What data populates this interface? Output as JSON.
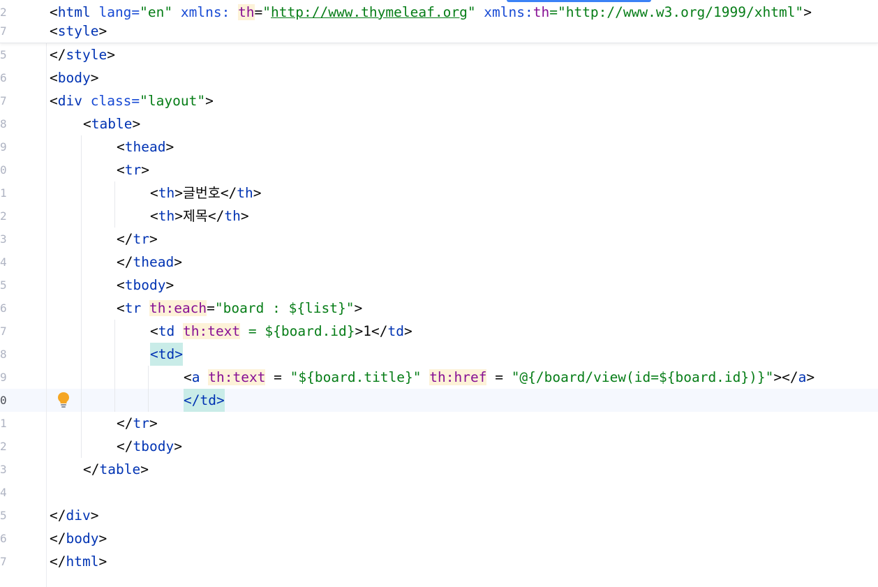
{
  "sticky": {
    "line_html": {
      "number": "2",
      "lt": "<",
      "tag": "html",
      "attr1": " lang=",
      "val1": "\"en\"",
      "attr2": " xmlns: ",
      "th1": "th",
      "eq": "=",
      "q1": "\"",
      "url": "http://www.thymeleaf.org",
      "q2": "\"",
      "attr3": " xmlns:",
      "th2": "th",
      "val3": "=\"http://www.w3.org/1999/xhtml\"",
      "gt": ">"
    },
    "line_style": {
      "number": "7",
      "open": "<",
      "tag": "style",
      "close": ">"
    }
  },
  "lines": {
    "l5": {
      "number": "5",
      "open": "</",
      "tag": "style",
      "close": ">"
    },
    "l6": {
      "number": "6",
      "open": "<",
      "tag": "body",
      "close": ">"
    },
    "l7": {
      "number": "7",
      "open": "<",
      "tag": "div",
      "attr": " class=",
      "val": "\"layout\"",
      "close": ">"
    },
    "l8": {
      "number": "8",
      "open": "<",
      "tag": "table",
      "close": ">"
    },
    "l9": {
      "number": "9",
      "open": "<",
      "tag": "thead",
      "close": ">"
    },
    "l10": {
      "number": "0",
      "open": "<",
      "tag": "tr",
      "close": ">"
    },
    "l11": {
      "number": "1",
      "open": "<",
      "tag": "th",
      "close": ">",
      "text": "글번호",
      "open2": "</",
      "tag2": "th",
      "close2": ">"
    },
    "l12": {
      "number": "2",
      "open": "<",
      "tag": "th",
      "close": ">",
      "text": "제목",
      "open2": "</",
      "tag2": "th",
      "close2": ">"
    },
    "l13": {
      "number": "3",
      "open": "</",
      "tag": "tr",
      "close": ">"
    },
    "l14": {
      "number": "4",
      "open": "</",
      "tag": "thead",
      "close": ">"
    },
    "l15": {
      "number": "5",
      "open": "<",
      "tag": "tbody",
      "close": ">"
    },
    "l16": {
      "number": "6",
      "open": "<",
      "tag": "tr",
      "sp": " ",
      "th": "th:each",
      "eq": "=",
      "val": "\"board : ${list}\"",
      "close": ">"
    },
    "l17": {
      "number": "7",
      "open": "<",
      "tag": "td",
      "sp": " ",
      "th": "th:text",
      "rest": " = ${board.id}",
      "close": ">",
      "text": "1",
      "open2": "</",
      "tag2": "td",
      "close2": ">"
    },
    "l18": {
      "number": "8",
      "full": "<td>"
    },
    "l19": {
      "number": "9",
      "open": "<",
      "tag": "a",
      "sp": " ",
      "th1": "th:text",
      "eq1": " = ",
      "val1": "\"${board.title}\"",
      "sp2": " ",
      "th2": "th:href",
      "eq2": " = ",
      "val2": "\"@{/board/view(id=${board.id})}\"",
      "close": ">",
      "open2": "</",
      "tag2": "a",
      "close2": ">"
    },
    "l20": {
      "number": "0",
      "full": "</td>"
    },
    "l21": {
      "number": "1",
      "open": "</",
      "tag": "tr",
      "close": ">"
    },
    "l22": {
      "number": "2",
      "open": "</",
      "tag": "tbody",
      "close": ">"
    },
    "l23": {
      "number": "3",
      "open": "</",
      "tag": "table",
      "close": ">"
    },
    "l24": {
      "number": "4"
    },
    "l25": {
      "number": "5",
      "open": "</",
      "tag": "div",
      "close": ">"
    },
    "l26": {
      "number": "6",
      "open": "</",
      "tag": "body",
      "close": ">"
    },
    "l27": {
      "number": "7",
      "open": "</",
      "tag": "html",
      "close": ">"
    }
  },
  "icons": {
    "intention": "lightbulb-icon"
  },
  "colors": {
    "tag": "#0033b3",
    "attribute": "#174ad4",
    "thymeleaf_attribute": "#871094",
    "string": "#067d17",
    "text": "#080808",
    "current_line": "#f5f8fe",
    "td_highlight": "#c9ece8",
    "th_highlight": "#fdf2d8",
    "bulb": "#f5a623"
  }
}
